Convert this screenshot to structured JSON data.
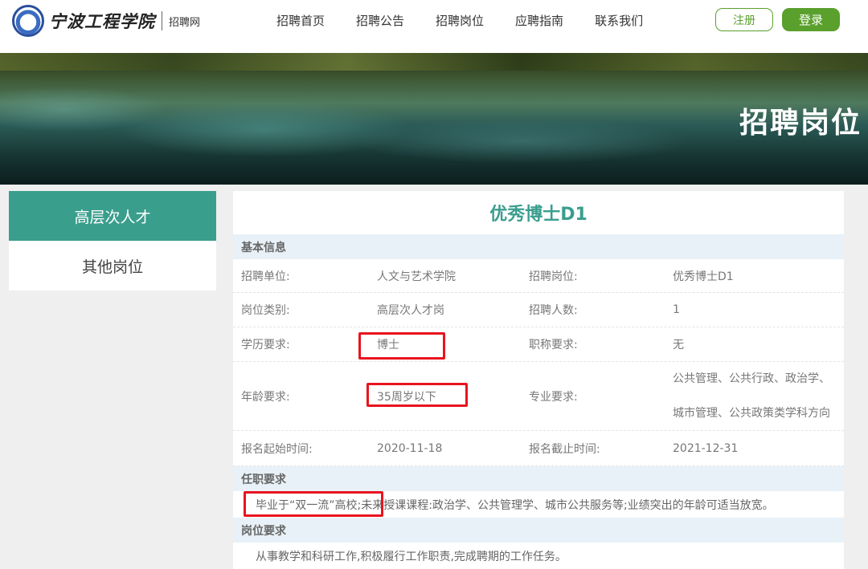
{
  "header": {
    "logo_name": "宁波工程学院",
    "logo_sub": "招聘网",
    "nav": [
      "招聘首页",
      "招聘公告",
      "招聘岗位",
      "应聘指南",
      "联系我们"
    ],
    "register_label": "注册",
    "login_label": "登录"
  },
  "banner": {
    "title": "招聘岗位"
  },
  "sidebar": {
    "items": [
      {
        "label": "高层次人才",
        "active": true
      },
      {
        "label": "其他岗位",
        "active": false
      }
    ]
  },
  "main": {
    "title": "优秀博士D1",
    "basic_header": "基本信息",
    "rows": {
      "unit": {
        "label": "招聘单位:",
        "value": "人文与艺术学院"
      },
      "post": {
        "label": "招聘岗位:",
        "value": "优秀博士D1"
      },
      "category": {
        "label": "岗位类别:",
        "value": "高层次人才岗"
      },
      "count": {
        "label": "招聘人数:",
        "value": "1"
      },
      "education": {
        "label": "学历要求:",
        "value": "博士"
      },
      "title_req": {
        "label": "职称要求:",
        "value": "无"
      },
      "age": {
        "label": "年龄要求:",
        "value": "35周岁以下"
      },
      "major": {
        "label": "专业要求:",
        "line1": "公共管理、公共行政、政治学、",
        "line2": "城市管理、公共政策类学科方向"
      },
      "start": {
        "label": "报名起始时间:",
        "value": "2020-11-18"
      },
      "end": {
        "label": "报名截止时间:",
        "value": "2021-12-31"
      }
    },
    "duty_header": "任职要求",
    "duty_text": "毕业于“双一流”高校;未来授课课程:政治学、公共管理学、城市公共服务等;业绩突出的年龄可适当放宽。",
    "job_header": "岗位要求",
    "job_text": "从事教学和科研工作,积极履行工作职责,完成聘期的工作任务。"
  },
  "colors": {
    "accent": "#3a9e8d",
    "brand_green": "#5aa02c",
    "highlight_red": "#e8141e",
    "section_bg": "#e8f1f7"
  }
}
